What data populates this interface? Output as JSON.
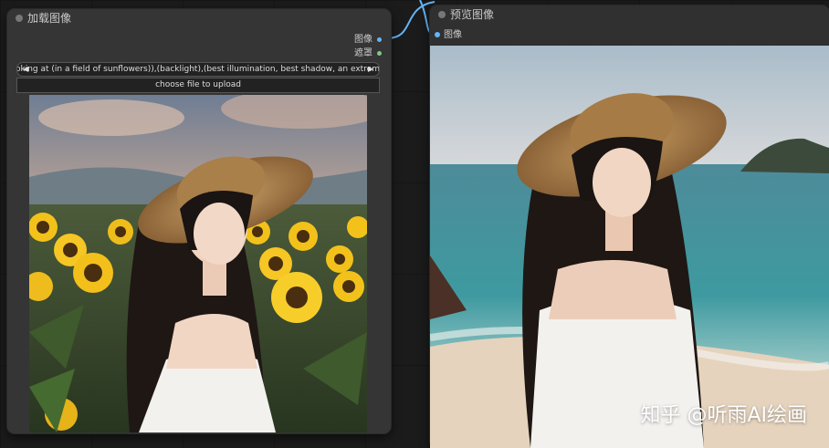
{
  "load_node": {
    "title": "加载图像",
    "outputs": [
      "图像",
      "遮罩"
    ],
    "output_colors": [
      "#64b5f6",
      "#81c784"
    ],
    "image_widget": {
      "name": "image",
      "value": "looking at (in a field of sunflowers)),(backlight),(best illumination, best shadow, an extremely.png"
    },
    "upload_button": "choose file to upload",
    "image_alt_scene": "sunflower-field-portrait"
  },
  "preview_node": {
    "title": "预览图像",
    "input": "图像",
    "image_alt_scene": "beach-portrait",
    "watermark": "知乎 @听雨AI绘画"
  },
  "colors": {
    "canvas_bg": "#1b1b1b",
    "node_bg": "#353535",
    "link_blue": "#64b5f6",
    "mask_green": "#81c784"
  }
}
